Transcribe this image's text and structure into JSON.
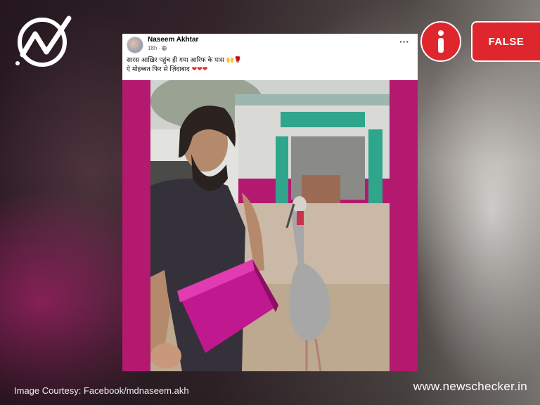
{
  "post": {
    "author": "Naseem Akhtar",
    "time": "18h",
    "privacy_icon": "globe-icon",
    "more_icon": "more-options-icon",
    "caption_line1": "सारस आख़िर पहुंच ही गया आरिफ के पास",
    "caption_line1_emoji": "🙌🌹",
    "caption_line2": "ऐ मोहब्बत फिर से ज़िंदाबाद",
    "caption_line2_emoji": "❤❤❤"
  },
  "badge": {
    "icon": "info-icon",
    "verdict": "FALSE",
    "color": "#e0262d"
  },
  "logo_icon": "newschecker-logo-icon",
  "footer": {
    "credit": "Image Courtesy: Facebook/mdnaseem.akh",
    "site": "www.newschecker.in"
  }
}
